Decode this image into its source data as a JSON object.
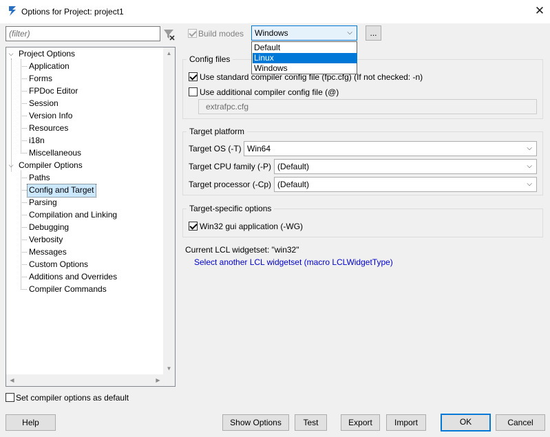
{
  "window": {
    "title": "Options for Project: project1",
    "icon": "lazarus-app-icon",
    "close_icon": "close-icon"
  },
  "filter": {
    "placeholder": "(filter)"
  },
  "tree": {
    "project_options": {
      "label": "Project Options",
      "children": [
        "Application",
        "Forms",
        "FPDoc Editor",
        "Session",
        "Version Info",
        "Resources",
        "i18n",
        "Miscellaneous"
      ]
    },
    "compiler_options": {
      "label": "Compiler Options",
      "children": [
        "Paths",
        "Config and Target",
        "Parsing",
        "Compilation and Linking",
        "Debugging",
        "Verbosity",
        "Messages",
        "Custom Options",
        "Additions and Overrides",
        "Compiler Commands"
      ],
      "selected": "Config and Target"
    }
  },
  "build_modes": {
    "label": "Build modes",
    "checked": true,
    "selected": "Windows",
    "options": [
      "Default",
      "Linux",
      "Windows"
    ],
    "highlighted": "Linux",
    "ellipsis": "..."
  },
  "config_files": {
    "title": "Config files",
    "use_standard": {
      "label": "Use standard compiler config file (fpc.cfg) (If not checked: -n)",
      "checked": true
    },
    "use_additional": {
      "label": "Use additional compiler config file (@)",
      "checked": false
    },
    "additional_value": "extrafpc.cfg"
  },
  "target_platform": {
    "title": "Target platform",
    "os": {
      "label": "Target OS (-T)",
      "value": "Win64"
    },
    "cpu": {
      "label": "Target CPU family (-P)",
      "value": "(Default)"
    },
    "processor": {
      "label": "Target processor (-Cp)",
      "value": "(Default)"
    }
  },
  "target_specific": {
    "title": "Target-specific options",
    "win32_gui": {
      "label": "Win32 gui application (-WG)",
      "checked": true
    }
  },
  "lcl": {
    "current": "Current LCL widgetset: \"win32\"",
    "link": "Select another LCL widgetset (macro LCLWidgetType)"
  },
  "set_default": {
    "label": "Set compiler options as default",
    "checked": false
  },
  "buttons": {
    "help": "Help",
    "show_options": "Show Options",
    "test": "Test",
    "export": "Export",
    "import": "Import",
    "ok": "OK",
    "cancel": "Cancel"
  },
  "colors": {
    "accent": "#0078d7",
    "selection": "#cce8ff",
    "link": "#0000cc"
  }
}
